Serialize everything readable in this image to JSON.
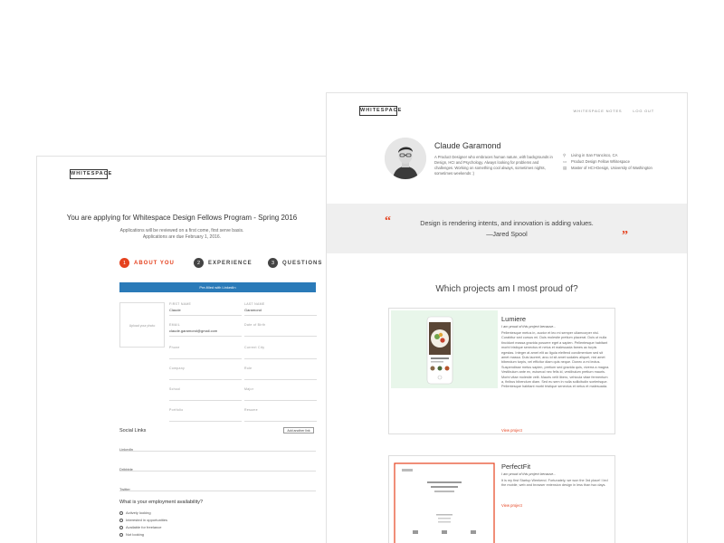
{
  "form": {
    "logo": "WHITESPACE",
    "title": "You are applying for Whitespace Design Fellows Program - Spring 2016",
    "sub_line1": "Applications will be reviewed on a first come, first serve basis.",
    "sub_line2": "Applications are due February 1, 2016.",
    "steps": [
      {
        "num": "1",
        "label": "ABOUT YOU"
      },
      {
        "num": "2",
        "label": "EXPERIENCE"
      },
      {
        "num": "3",
        "label": "QUESTIONS"
      }
    ],
    "prefill_label": "Pre-filled with LinkedIn",
    "photo_label": "Upload your photo",
    "fields": {
      "first_name": {
        "label": "FIRST NAME",
        "value": "Claude"
      },
      "last_name": {
        "label": "LAST NAME",
        "value": "Garamond"
      },
      "email": {
        "label": "EMAIL",
        "value": "claude.garamond@gmail.com"
      },
      "dob": {
        "label": "Date of Birth",
        "value": ""
      },
      "phone": {
        "label": "Phone",
        "value": ""
      },
      "city": {
        "label": "Current City",
        "value": ""
      },
      "company": {
        "label": "Company",
        "value": ""
      },
      "role": {
        "label": "Role",
        "value": ""
      },
      "school": {
        "label": "School",
        "value": ""
      },
      "major": {
        "label": "Major",
        "value": ""
      },
      "portfolio": {
        "label": "Portfolio",
        "value": ""
      },
      "resume": {
        "label": "Resume",
        "value": ""
      }
    },
    "social_title": "Social Links",
    "add_link_label": "Add another link",
    "social": [
      "LinkedIn",
      "Dribbble",
      "Twitter"
    ],
    "employment_title": "What is your employment availability?",
    "employment_options": [
      "Actively looking",
      "Interested in opportunities",
      "Available for freelance",
      "Not looking"
    ]
  },
  "profile": {
    "logo": "WHITESPACE",
    "nav": [
      "WHITESPACE NOTES",
      "LOG OUT"
    ],
    "name": "Claude Garamond",
    "bio": "A Product Designer who embraces human nature, with backgrounds in Design, HCI and Psychology. Always looking for problems and challenges. Working on something cool always, sometimes nights, sometimes weekends :)",
    "facts": [
      {
        "icon": "location-icon",
        "glyph": "⚲",
        "text": "Living in San Francisco, CA"
      },
      {
        "icon": "laptop-icon",
        "glyph": "▭",
        "text": "Product Design Fellow Whitespace"
      },
      {
        "icon": "graduation-cap-icon",
        "glyph": "▤",
        "text": "Master of HCI+Design, University of Washington"
      }
    ],
    "quote": "Design is rendering intents, and innovation is adding values.",
    "quote_author": "—Jared Spool",
    "open_quote": "“",
    "close_quote": "”",
    "projects_heading": "Which projects am I most proud of?",
    "projects": [
      {
        "title": "Lumiere",
        "proud": "I am proud of this project because...",
        "body": "Pellentesque metus in, auctor et leo mi semper ullamcorper nisl. Curabitur sed cursus mi. Duis molestie pretium placerat. Duis ut nulla tincidunt massa gravida posuere eget a sapien. Pellentesque habitant morbi tristique senectus et netus et malesuada fames ac turpis egestas. Integer at amet elit ac ligula eleifend condimentum sed sit amet massa. Duis laoreet, arcu id sit amet sodales aliquet, nisl amet bibendum turpis, vel efficitur diam quis neque. Donec a mi lectus. Suspendisse metus sapien, pretium sed gravida quis, viverra a magna. Vestibulum ante ex, euismod nec felis id, vestibulum pretium mauris. Morbi vitae molestie velit. Mauris velit libero, vehicula vitae fermentum a, finibus bibendum diam. Sed eu sem in nulla sollicitudin scelerisque. Pellentesque habitant morbi tristique senectus et netus et malesuada.",
        "link": "View project"
      },
      {
        "title": "PerfectFit",
        "proud": "I am proud of this project because...",
        "body": "It is my first Startup Weekend. Fortunately, we won the 3rd place! I led the mobile, web and browser extension design in less than two days.",
        "link": "View project"
      }
    ]
  },
  "colors": {
    "accent": "#e5421f",
    "linkedin_blue": "#2a7ab8",
    "quote_band": "#efefef",
    "lumiere_bg": "#e8f6ea"
  }
}
